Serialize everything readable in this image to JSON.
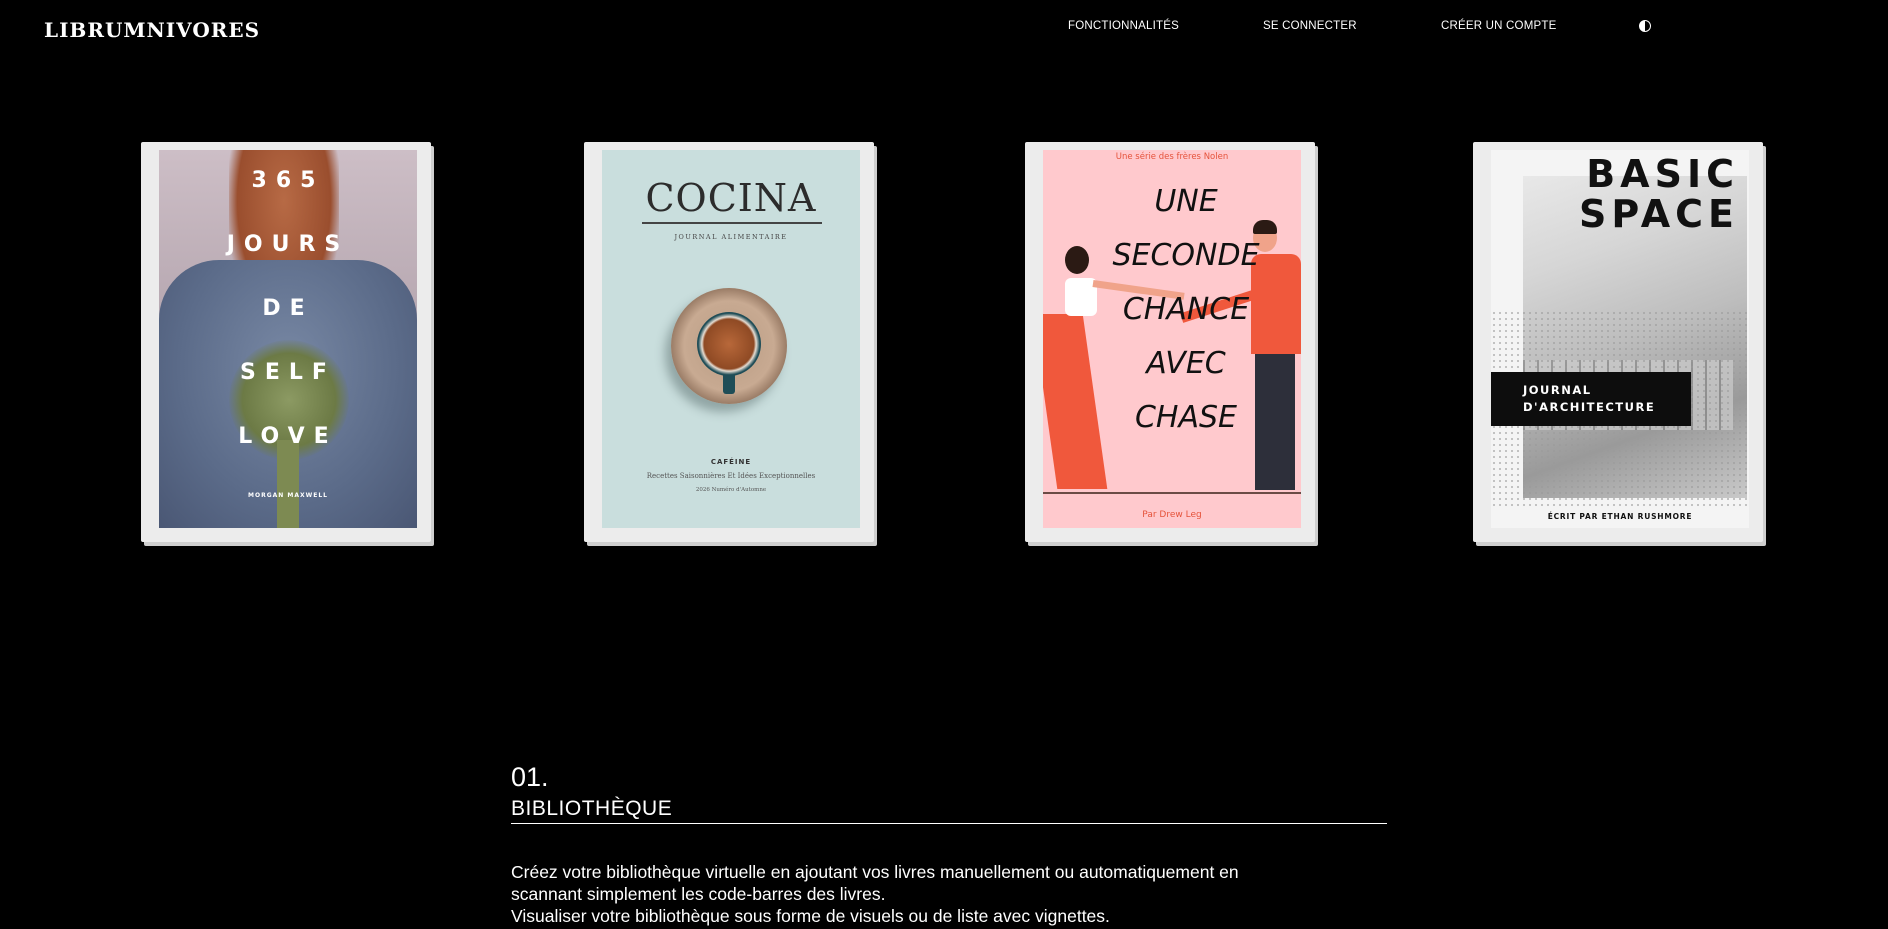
{
  "header": {
    "logo": "LIBRUMNIVORES",
    "nav": {
      "features": "FONCTIONNALITÉS",
      "login": "SE CONNECTER",
      "register": "CRÉER UN COMPTE"
    },
    "theme_toggle_icon": "contrast-icon"
  },
  "books": [
    {
      "lines": [
        "365",
        "JOURS",
        "DE",
        "SELF",
        "LOVE"
      ],
      "author": "MORGAN MAXWELL"
    },
    {
      "title": "COCINA",
      "subtitle": "JOURNAL ALIMENTAIRE",
      "caption_title": "CAFÉINE",
      "caption": "Recettes Saisonnières Et Idées Exceptionnelles",
      "edition": "2026 Numéro d'Automne"
    },
    {
      "series": "Une série des frères Nolen",
      "lines": [
        "UNE",
        "SECONDE",
        "CHANCE",
        "AVEC",
        "CHASE"
      ],
      "author": "Par Drew Leg"
    },
    {
      "title_line1": "BASIC",
      "title_line2": "SPACE",
      "tag": "JOURNAL\nD'ARCHITECTURE",
      "author": "ÉCRIT PAR ETHAN RUSHMORE"
    }
  ],
  "section": {
    "number": "01.",
    "title": "BIBLIOTHÈQUE",
    "description_line1": "Créez votre bibliothèque virtuelle en ajoutant vos livres manuellement ou automatiquement en",
    "description_line2": "scannant simplement les code-barres des livres.",
    "description_line3": "Visualiser votre bibliothèque sous forme de visuels ou de liste avec vignettes."
  }
}
